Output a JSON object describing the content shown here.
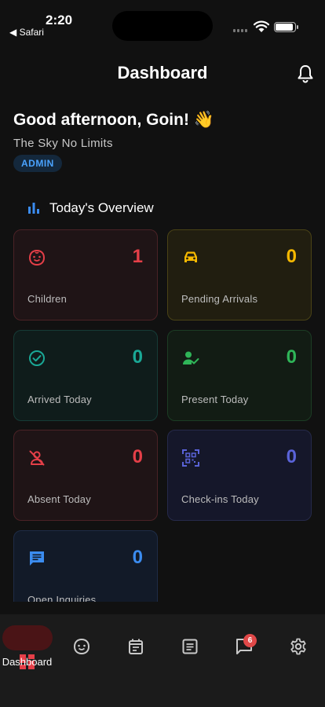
{
  "status_bar": {
    "time": "2:20",
    "back_app": "◀ Safari"
  },
  "header": {
    "title": "Dashboard"
  },
  "greeting": {
    "text": "Good afternoon, Goin! 👋",
    "organization": "The Sky No Limits",
    "role": "ADMIN"
  },
  "section": {
    "title": "Today's Overview"
  },
  "cards": {
    "children": {
      "value": "1",
      "label": "Children",
      "color": "#e53f48"
    },
    "pending": {
      "value": "0",
      "label": "Pending Arrivals",
      "color": "#f5b800"
    },
    "arrived": {
      "value": "0",
      "label": "Arrived Today",
      "color": "#1aa896"
    },
    "present": {
      "value": "0",
      "label": "Present Today",
      "color": "#2fb558"
    },
    "absent": {
      "value": "0",
      "label": "Absent Today",
      "color": "#e53f48"
    },
    "checkins": {
      "value": "0",
      "label": "Check-ins Today",
      "color": "#5a63d8"
    },
    "inquiries": {
      "value": "0",
      "label": "Open Inquiries",
      "color": "#3b8cf0"
    }
  },
  "tabbar": {
    "items": [
      {
        "label": "Dashboard",
        "icon": "dashboard-icon",
        "active": true
      },
      {
        "label": "",
        "icon": "child-face-icon"
      },
      {
        "label": "",
        "icon": "calendar-icon"
      },
      {
        "label": "",
        "icon": "list-icon"
      },
      {
        "label": "",
        "icon": "chat-icon"
      },
      {
        "label": "",
        "icon": "gear-icon"
      }
    ],
    "messages_badge": "6"
  }
}
